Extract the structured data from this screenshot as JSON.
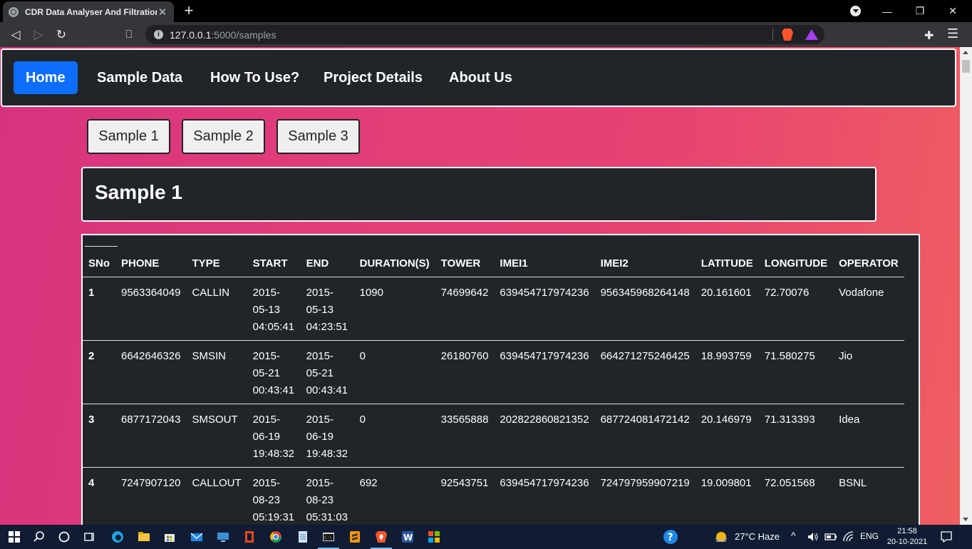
{
  "browser": {
    "tab_title": "CDR Data Analyser And Filtration",
    "tab_close": "✕",
    "new_tab": "+",
    "url_host": "127.0.0.1",
    "url_path": ":5000/samples",
    "minimize": "—",
    "maximize": "❐",
    "close": "✕"
  },
  "nav": {
    "items": [
      {
        "label": "Home",
        "active": true
      },
      {
        "label": "Sample Data"
      },
      {
        "label": "How To Use?"
      },
      {
        "label": "Project Details"
      },
      {
        "label": "About Us"
      }
    ]
  },
  "samples": {
    "buttons": [
      "Sample 1",
      "Sample 2",
      "Sample 3"
    ],
    "card_title": "Sample 1"
  },
  "table": {
    "headers": [
      "SNo",
      "PHONE",
      "TYPE",
      "START",
      "END",
      "DURATION(S)",
      "TOWER",
      "IMEI1",
      "IMEI2",
      "LATITUDE",
      "LONGITUDE",
      "OPERATOR"
    ],
    "rows": [
      [
        "1",
        "9563364049",
        "CALLIN",
        "2015-05-13 04:05:41",
        "2015-05-13 04:23:51",
        "1090",
        "74699642",
        "639454717974236",
        "956345968264148",
        "20.161601",
        "72.70076",
        "Vodafone"
      ],
      [
        "2",
        "6642646326",
        "SMSIN",
        "2015-05-21 00:43:41",
        "2015-05-21 00:43:41",
        "0",
        "26180760",
        "639454717974236",
        "664271275246425",
        "18.993759",
        "71.580275",
        "Jio"
      ],
      [
        "3",
        "6877172043",
        "SMSOUT",
        "2015-06-19 19:48:32",
        "2015-06-19 19:48:32",
        "0",
        "33565888",
        "202822860821352",
        "687724081472142",
        "20.146979",
        "71.313393",
        "Idea"
      ],
      [
        "4",
        "7247907120",
        "CALLOUT",
        "2015-08-23 05:19:31",
        "2015-08-23 05:31:03",
        "692",
        "92543751",
        "639454717974236",
        "724797959907219",
        "19.009801",
        "72.051568",
        "BSNL"
      ]
    ]
  },
  "taskbar": {
    "weather": "27°C  Haze",
    "lang": "ENG",
    "time": "21:58",
    "date": "20-10-2021"
  }
}
